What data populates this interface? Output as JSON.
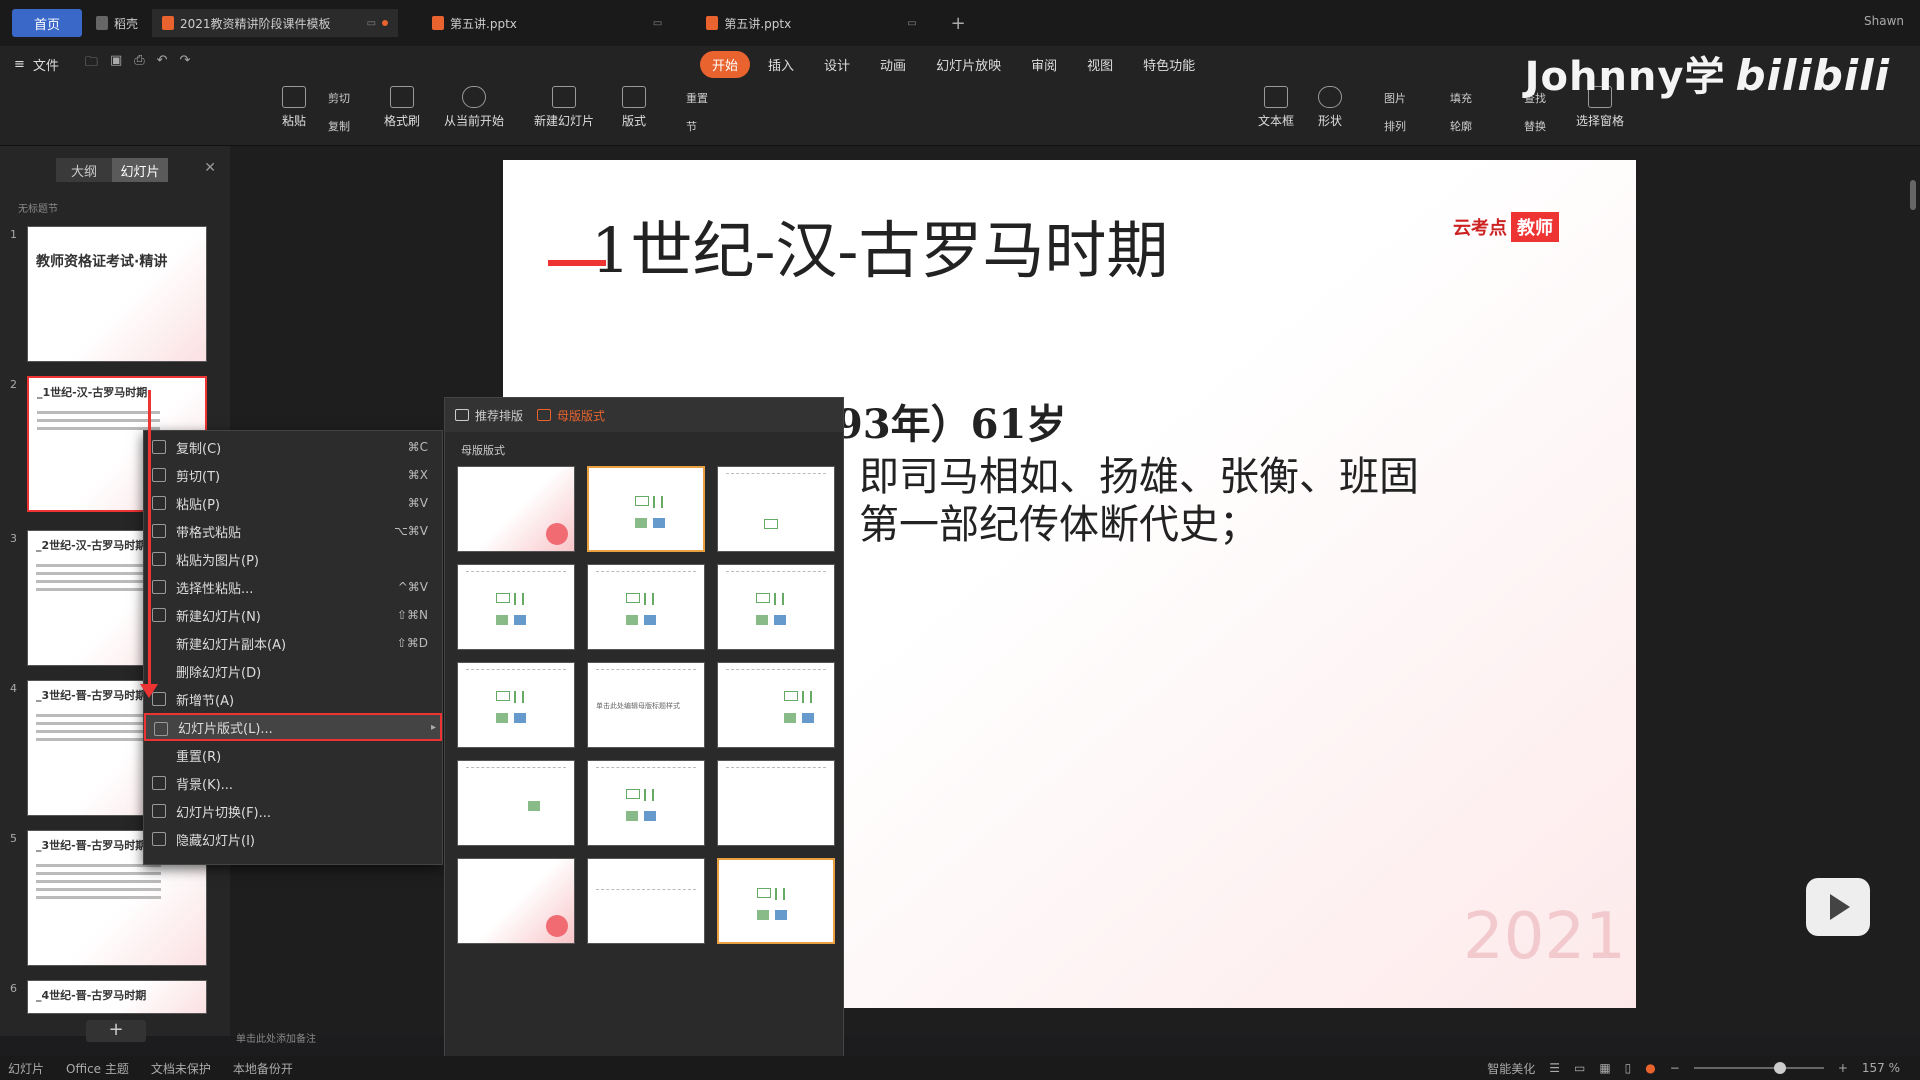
{
  "tabs": {
    "home": "首页",
    "wps": "稻壳",
    "docs": [
      {
        "label": "2021教资精讲阶段课件模板"
      },
      {
        "label": "第五讲.pptx"
      },
      {
        "label": "第五讲.pptx"
      }
    ],
    "user": "Shawn"
  },
  "menubar": {
    "file": "文件",
    "tabs": [
      "开始",
      "插入",
      "设计",
      "动画",
      "幻灯片放映",
      "审阅",
      "视图",
      "特色功能"
    ]
  },
  "ribbon": {
    "paste": "粘贴",
    "cut": "剪切",
    "copy": "复制",
    "format_painter": "格式刷",
    "from_current": "从当前开始",
    "new_slide": "新建幻灯片",
    "layout": "版式",
    "reset": "重置",
    "section": "节",
    "textbox": "文本框",
    "shape": "形状",
    "picture": "图片",
    "fill": "填充",
    "arrange": "排列",
    "outline": "轮廓",
    "find": "查找",
    "replace": "替换",
    "select_pane": "选择窗格"
  },
  "watermark": {
    "name": "Johnny学",
    "brand": "bilibili"
  },
  "sidebar": {
    "tab_outline": "大纲",
    "tab_slides": "幻灯片",
    "section": "无标题节",
    "slides": [
      {
        "num": "1",
        "title": "教师资格证考试·精讲"
      },
      {
        "num": "2",
        "title": "_1世纪-汉-古罗马时期"
      },
      {
        "num": "3",
        "title": "_2世纪-汉-古罗马时期"
      },
      {
        "num": "4",
        "title": "_3世纪-晋-古罗马时期"
      },
      {
        "num": "5",
        "title": "_3世纪-晋-古罗马时期"
      },
      {
        "num": "6",
        "title": "_4世纪-晋-古罗马时期"
      }
    ],
    "add": "+"
  },
  "slide": {
    "title": "1世纪-汉-古罗马时期",
    "logo_main": "云考点",
    "logo_badge": "教师",
    "line1": "93年）61岁",
    "line2": "即司马相如、扬雄、张衡、班固",
    "line3": "第一部纪传体断代史；",
    "year": "2021"
  },
  "notes": "单击此处添加备注",
  "context_menu": [
    {
      "label": "复制(C)",
      "shortcut": "⌘C"
    },
    {
      "label": "剪切(T)",
      "shortcut": "⌘X"
    },
    {
      "label": "粘贴(P)",
      "shortcut": "⌘V"
    },
    {
      "label": "带格式粘贴",
      "shortcut": "⌥⌘V"
    },
    {
      "label": "粘贴为图片(P)",
      "shortcut": ""
    },
    {
      "label": "选择性粘贴...",
      "shortcut": "^⌘V"
    },
    {
      "label": "新建幻灯片(N)",
      "shortcut": "⇧⌘N"
    },
    {
      "label": "新建幻灯片副本(A)",
      "shortcut": "⇧⌘D"
    },
    {
      "label": "删除幻灯片(D)",
      "shortcut": ""
    },
    {
      "label": "新增节(A)",
      "shortcut": ""
    },
    {
      "label": "幻灯片版式(L)...",
      "shortcut": ""
    },
    {
      "label": "重置(R)",
      "shortcut": ""
    },
    {
      "label": "背景(K)...",
      "shortcut": ""
    },
    {
      "label": "幻灯片切换(F)...",
      "shortcut": ""
    },
    {
      "label": "隐藏幻灯片(I)",
      "shortcut": ""
    }
  ],
  "layout_panel": {
    "tab_recommended": "推荐排版",
    "tab_master": "母版版式",
    "section_label": "母版版式",
    "title_only_text": "单击此处编辑母版标题样式"
  },
  "statusbar": {
    "slide": "幻灯片",
    "theme": "Office 主题",
    "protect": "文档未保护",
    "backup": "本地备份开",
    "beautify": "智能美化",
    "zoom": "157 %"
  },
  "colors": {
    "accent": "#e8632e",
    "highlight": "#e33333",
    "home_tab": "#3a68c9"
  }
}
